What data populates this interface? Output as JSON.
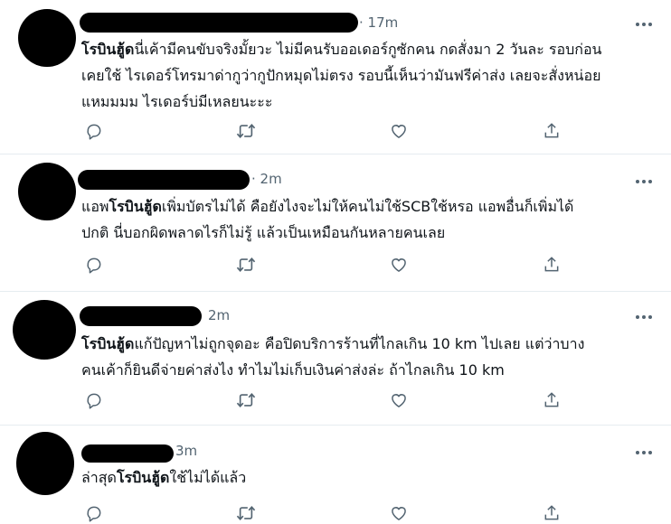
{
  "icons": {
    "more": "more-horizontal-icon",
    "reply": "reply-icon",
    "retweet": "retweet-icon",
    "like": "like-icon",
    "share": "share-icon"
  },
  "colors": {
    "text": "#0f1419",
    "muted": "#536471",
    "divider": "#e6ecf0",
    "redaction": "#000000"
  },
  "tweets": [
    {
      "time": "· 17m",
      "lines": [
        {
          "bold": "โรบินฮู้ด",
          "rest": "นี่เค้ามีคนขับจริงมั้ยวะ ไม่มีคนรับออเดอร์กูซักคน กดสั่งมา 2 วันละ รอบก่อน"
        },
        {
          "bold": "",
          "rest": "เคยใช้ ไรเดอร์โทรมาด่ากูว่ากูปักหมุดไม่ตรง รอบนี้เห็นว่ามันฟรีค่าส่ง เลยจะสั่งหน่อย"
        },
        {
          "bold": "",
          "rest": "แหมมมม ไรเดอร์บ่มีเหลยนะะะ"
        }
      ]
    },
    {
      "time": "· 2m",
      "lines": [
        {
          "pre": "แอพ",
          "bold": "โรบินฮู้ด",
          "rest": "เพิ่มบัตรไม่ได้ คือยังไงจะไม่ให้คนไม่ใช้SCBใช้หรอ แอพอื่นก็เพิ่มได้"
        },
        {
          "pre": "",
          "bold": "",
          "rest": "ปกติ นี่บอกผิดพลาดไรก็ไม่รู้ แล้วเป็นเหมือนกันหลายคนเลย"
        }
      ]
    },
    {
      "time": "2m",
      "lines": [
        {
          "bold": "โรบินฮู้ด",
          "rest": "แก้ปัญหาไม่ถูกจุดอะ คือปิดบริการร้านที่ไกลเกิน 10 km ไปเลย แต่ว่าบาง"
        },
        {
          "bold": "",
          "rest": "คนเค้าก็ยินดีจ่ายค่าส่งไง ทำไมไม่เก็บเงินค่าส่งล่ะ ถ้าไกลเกิน 10 km"
        }
      ]
    },
    {
      "time": "3m",
      "lines": [
        {
          "pre": "ล่าสุด",
          "bold": "โรบินฮู้ด",
          "rest": "ใช้ไม่ได้แล้ว"
        }
      ]
    }
  ]
}
